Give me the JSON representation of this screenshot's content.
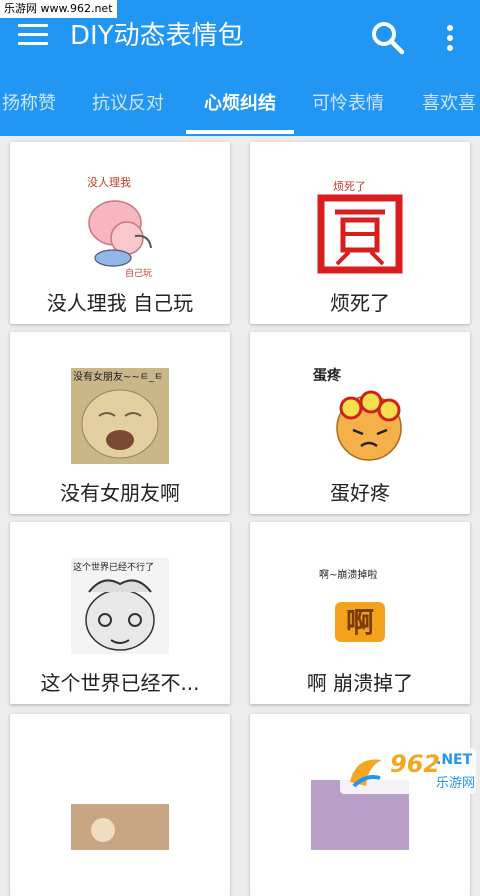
{
  "watermark": {
    "site": "乐游网 www.962.net"
  },
  "appbar": {
    "title": "DIY动态表情包",
    "menu_icon": "hamburger-menu-icon",
    "search_icon": "search-icon",
    "more_icon": "more-vertical-icon",
    "color": "#2196f3"
  },
  "tabs": [
    {
      "label": "扬称赞"
    },
    {
      "label": "抗议反对"
    },
    {
      "label": "心烦纠结",
      "active": true
    },
    {
      "label": "可怜表情"
    },
    {
      "label": "喜欢喜"
    }
  ],
  "cards": [
    {
      "caption": "没人理我 自己玩",
      "image_text_top": "没人理我",
      "image_text_bottom": "自己玩"
    },
    {
      "caption": "烦死了",
      "image_text_top": "烦死了"
    },
    {
      "caption": "没有女朋友啊",
      "image_text_top": "没有女朋友~~ㅌ_ㅌ"
    },
    {
      "caption": "蛋好疼",
      "image_text_top": "蛋疼"
    },
    {
      "caption": "这个世界已经不...",
      "image_text_top": "这个世界已经不行了"
    },
    {
      "caption": "啊 崩溃掉了",
      "image_text_top": "啊~崩溃掉啦",
      "image_text_big": "啊"
    },
    {
      "caption": ""
    },
    {
      "caption": ""
    }
  ],
  "bottom_watermark": {
    "num": "962",
    "net": ".NET",
    "cn": "乐游网"
  }
}
